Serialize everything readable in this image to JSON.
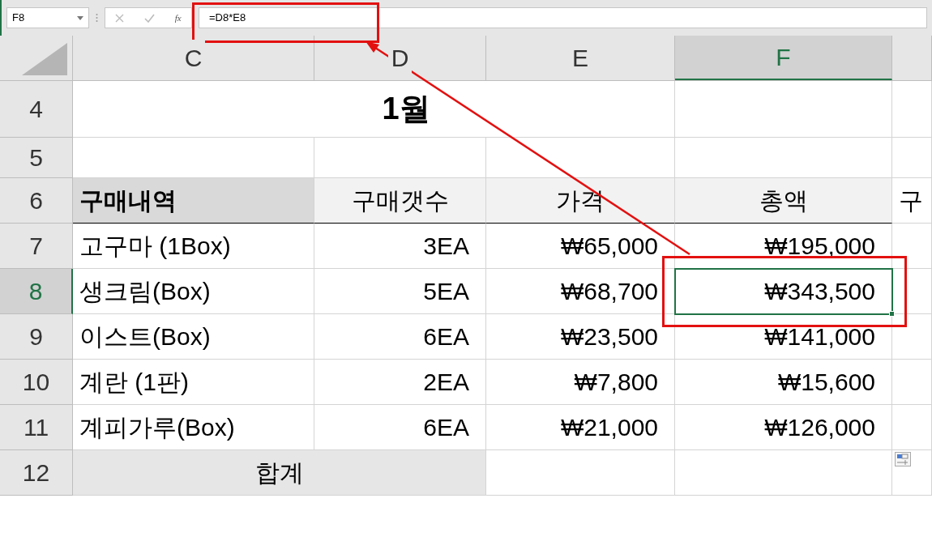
{
  "formula_bar": {
    "name_box": "F8",
    "function_label": "fx",
    "formula": "=D8*E8"
  },
  "columns": [
    {
      "label": "C",
      "selected": false
    },
    {
      "label": "D",
      "selected": false
    },
    {
      "label": "E",
      "selected": false
    },
    {
      "label": "F",
      "selected": true
    },
    {
      "selected": false
    }
  ],
  "rows": [
    {
      "header": "4",
      "selected": false,
      "cells": [
        {
          "kind": "title",
          "text": "1월",
          "selected": false
        },
        {
          "kind": "blank",
          "selected": false
        },
        {
          "kind": "blank",
          "selected": false
        }
      ]
    },
    {
      "header": "5",
      "selected": false,
      "cells": [
        {
          "kind": "blank",
          "selected": false
        },
        {
          "kind": "blank",
          "selected": false
        },
        {
          "kind": "blank",
          "selected": false
        },
        {
          "kind": "blank",
          "selected": false
        },
        {
          "kind": "blank",
          "selected": false
        }
      ]
    },
    {
      "header": "6",
      "selected": false,
      "cells": [
        {
          "kind": "label",
          "text": "구매내역",
          "selected": false
        },
        {
          "kind": "heading",
          "text": "구매갯수",
          "selected": false
        },
        {
          "kind": "heading",
          "text": "가격",
          "selected": false
        },
        {
          "kind": "heading",
          "text": "총액",
          "selected": false
        },
        {
          "kind": "text",
          "text": "구",
          "selected": false
        }
      ]
    },
    {
      "header": "7",
      "selected": false,
      "cells": [
        {
          "kind": "text",
          "text": "고구마 (1Box)",
          "selected": false
        },
        {
          "kind": "number",
          "text": "3EA",
          "selected": false
        },
        {
          "kind": "number",
          "text": "₩65,000",
          "selected": false
        },
        {
          "kind": "number",
          "text": "₩195,000",
          "selected": false
        },
        {
          "kind": "blank",
          "selected": false
        }
      ]
    },
    {
      "header": "8",
      "selected": true,
      "cells": [
        {
          "kind": "text",
          "text": "생크림(Box)",
          "selected": false
        },
        {
          "kind": "number",
          "text": "5EA",
          "selected": false
        },
        {
          "kind": "number",
          "text": "₩68,700",
          "selected": false
        },
        {
          "kind": "number",
          "text": "₩343,500",
          "selected": true
        },
        {
          "kind": "blank",
          "selected": false
        }
      ]
    },
    {
      "header": "9",
      "selected": false,
      "cells": [
        {
          "kind": "text",
          "text": "이스트(Box)",
          "selected": false
        },
        {
          "kind": "number",
          "text": "6EA",
          "selected": false
        },
        {
          "kind": "number",
          "text": "₩23,500",
          "selected": false
        },
        {
          "kind": "number",
          "text": "₩141,000",
          "selected": false
        },
        {
          "kind": "blank",
          "selected": false
        }
      ]
    },
    {
      "header": "10",
      "selected": false,
      "cells": [
        {
          "kind": "text",
          "text": "계란 (1판)",
          "selected": false
        },
        {
          "kind": "number",
          "text": "2EA",
          "selected": false
        },
        {
          "kind": "number",
          "text": "₩7,800",
          "selected": false
        },
        {
          "kind": "number",
          "text": "₩15,600",
          "selected": false
        },
        {
          "kind": "blank",
          "selected": false
        }
      ]
    },
    {
      "header": "11",
      "selected": false,
      "cells": [
        {
          "kind": "text",
          "text": "계피가루(Box)",
          "selected": false
        },
        {
          "kind": "number",
          "text": "6EA",
          "selected": false
        },
        {
          "kind": "number",
          "text": "₩21,000",
          "selected": false
        },
        {
          "kind": "number",
          "text": "₩126,000",
          "selected": false
        },
        {
          "kind": "blank",
          "selected": false
        }
      ]
    },
    {
      "header": "12",
      "selected": false,
      "cells": [
        {
          "kind": "total",
          "text": "합계",
          "selected": false
        },
        {
          "kind": "blank",
          "selected": false
        },
        {
          "kind": "blank",
          "selected": false
        },
        {
          "kind": "blank",
          "selected": false
        }
      ]
    }
  ]
}
